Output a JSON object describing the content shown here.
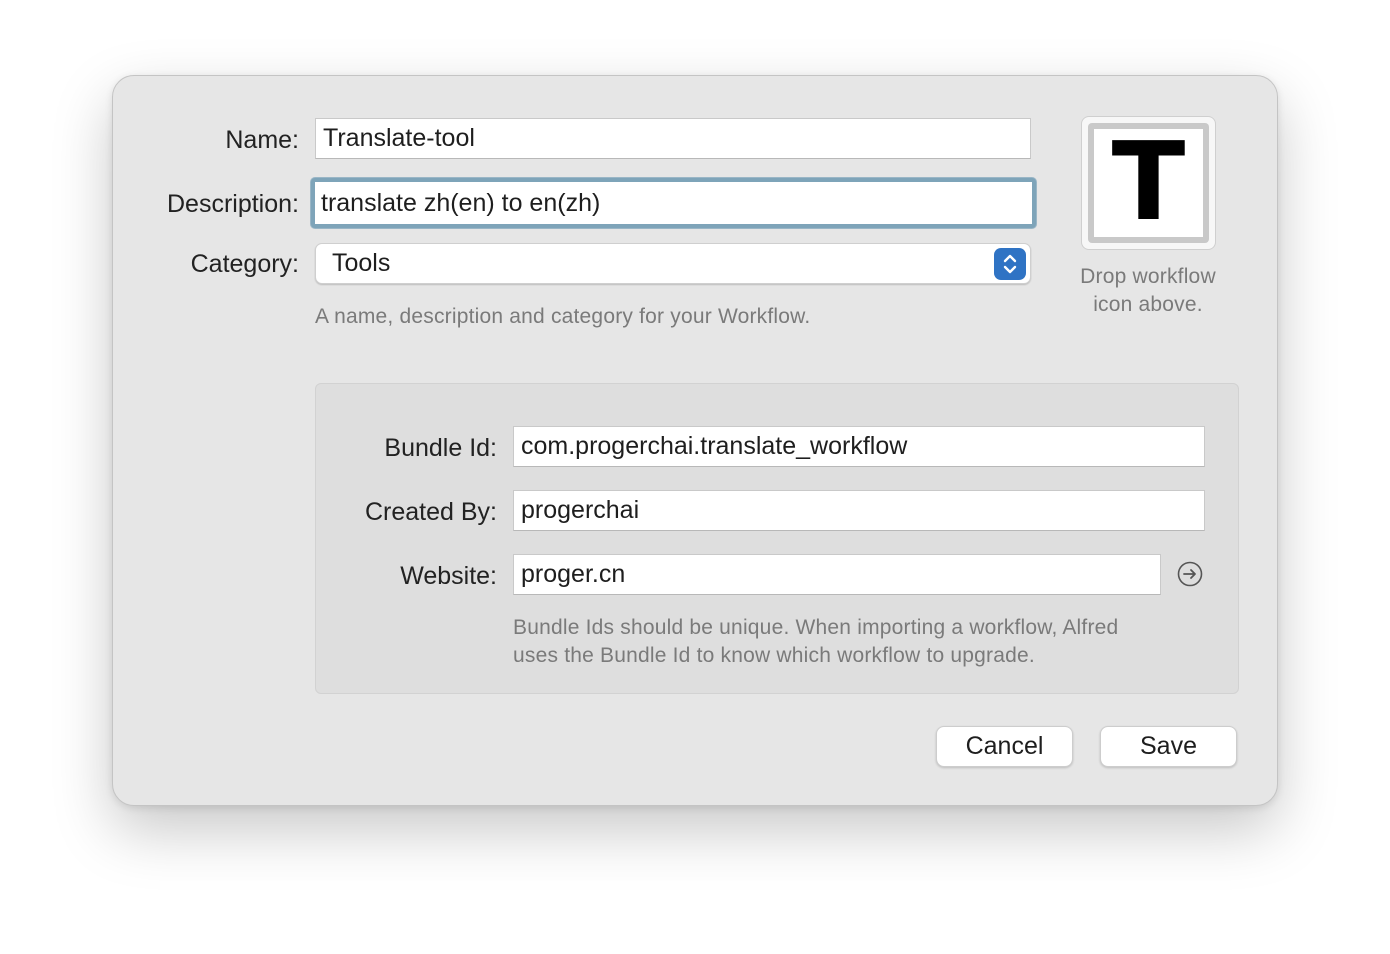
{
  "form": {
    "name_label": "Name:",
    "name_value": "Translate-tool",
    "description_label": "Description:",
    "description_value": "translate zh(en) to en(zh)",
    "category_label": "Category:",
    "category_value": "Tools",
    "hint": "A name, description and category for your Workflow."
  },
  "icon_well": {
    "letter": "T",
    "caption_line1": "Drop workflow",
    "caption_line2": "icon above."
  },
  "bundle": {
    "bundle_id_label": "Bundle Id:",
    "bundle_id_value": "com.progerchai.translate_workflow",
    "created_by_label": "Created By:",
    "created_by_value": "progerchai",
    "website_label": "Website:",
    "website_value": "proger.cn",
    "hint_line1": "Bundle Ids should be unique. When importing a workflow, Alfred",
    "hint_line2": "uses the Bundle Id to know which workflow to upgrade."
  },
  "buttons": {
    "cancel": "Cancel",
    "save": "Save"
  },
  "colors": {
    "dialog_background": "#e6e6e6",
    "panel_background": "#dedede",
    "focus_ring": "#7ea4b9",
    "popup_accent": "#2f73c4"
  },
  "icons": {
    "popup_stepper": "chevron-up-down-icon",
    "website_go": "arrow-right-circle-icon"
  }
}
